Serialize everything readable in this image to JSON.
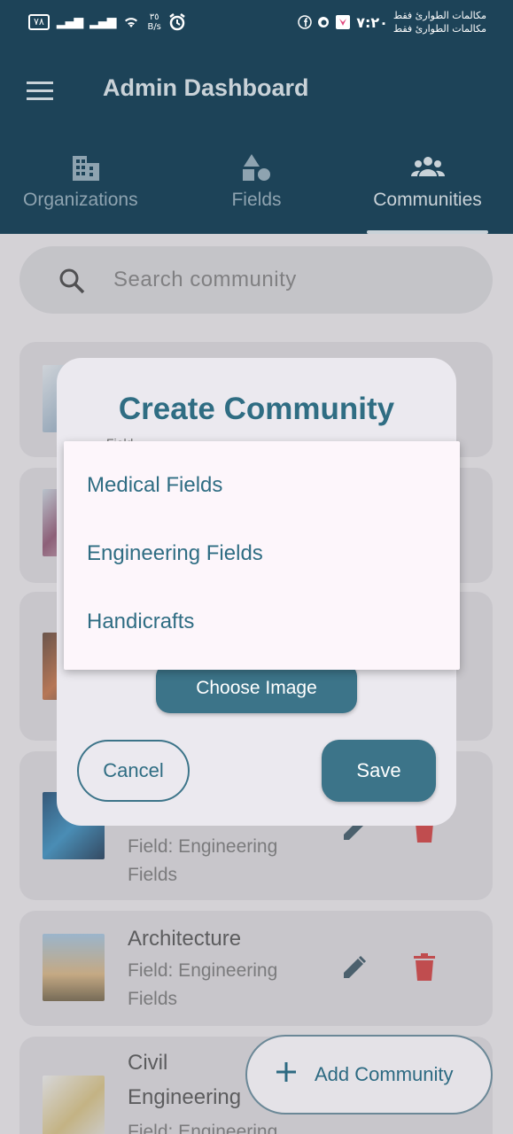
{
  "status_bar": {
    "battery": "٧٨",
    "speed_value": "٣٥",
    "speed_unit": "B/s",
    "time": "٧:٢٠",
    "carrier_line1": "مكالمات الطوارئ فقط",
    "carrier_line2": "مكالمات الطوارئ فقط"
  },
  "app_bar": {
    "title": "Admin Dashboard"
  },
  "tabs": [
    {
      "label": "Organizations",
      "icon": "building-icon"
    },
    {
      "label": "Fields",
      "icon": "shapes-icon"
    },
    {
      "label": "Communities",
      "icon": "people-icon",
      "active": true
    }
  ],
  "search": {
    "placeholder": "Search community"
  },
  "communities": [
    {
      "title": "",
      "field": ""
    },
    {
      "title": "",
      "field": ""
    },
    {
      "title": "",
      "field": ""
    },
    {
      "title": "",
      "field_line1": "Field: Engineering",
      "field_line2": "Fields"
    },
    {
      "title": "Architecture",
      "field_line1": "Field: Engineering",
      "field_line2": "Fields"
    },
    {
      "title_line1": "Civil",
      "title_line2": "Engineering",
      "field_line1": "Field: Engineering"
    }
  ],
  "fab": {
    "label": "Add Community"
  },
  "dialog": {
    "title": "Create Community",
    "field_label": "Field",
    "choose_image_label": "Choose Image",
    "cancel_label": "Cancel",
    "save_label": "Save"
  },
  "dropdown": {
    "options": [
      "Medical Fields",
      "Engineering Fields",
      "Handicrafts"
    ]
  },
  "colors": {
    "appbar": "#1d4358",
    "primary": "#3c7489",
    "accent_text": "#2f6d83",
    "delete": "#d32f2f"
  }
}
